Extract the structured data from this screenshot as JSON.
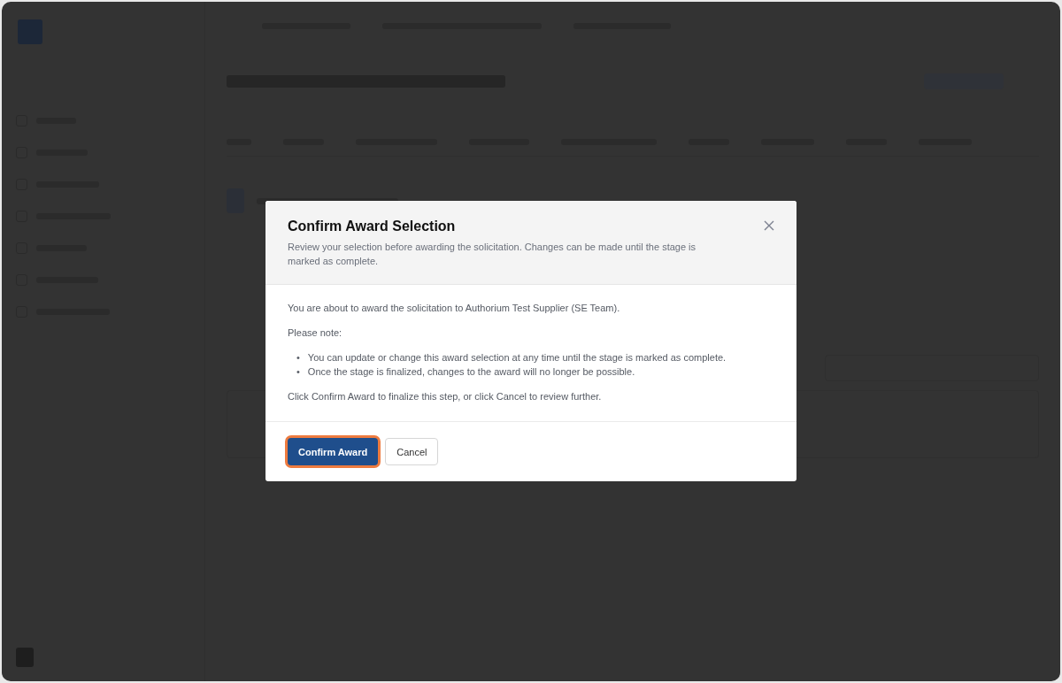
{
  "dialog": {
    "title": "Confirm Award Selection",
    "subtitle": "Review your selection before awarding the solicitation. Changes can be made until the stage is marked as complete.",
    "intro": "You are about to award the solicitation to Authorium Test Supplier (SE Team).",
    "note_label": "Please note:",
    "notes": [
      {
        "marker": "•",
        "text": "You can update or change this award selection at any time until the stage is marked as complete."
      },
      {
        "marker": "•",
        "text": "Once the stage is finalized, changes to the award will no longer be possible."
      }
    ],
    "outro": "Click Confirm Award to finalize this step, or click Cancel to review further.",
    "buttons": [
      {
        "label": "Confirm Award",
        "kind": "primary",
        "focused": true
      },
      {
        "label": "Cancel",
        "kind": "secondary",
        "focused": false
      }
    ]
  }
}
